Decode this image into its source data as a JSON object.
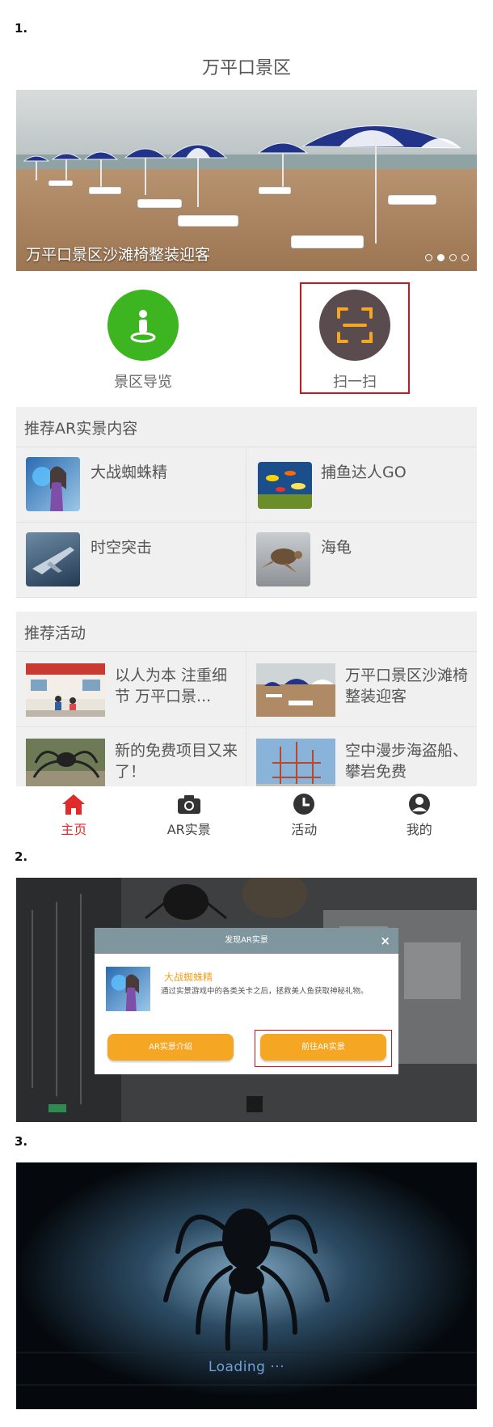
{
  "steps": [
    "1.",
    "2.",
    "3."
  ],
  "app": {
    "title": "万平口景区"
  },
  "banner": {
    "caption": "万平口景区沙滩椅整装迎客",
    "slide_count": 4,
    "active_slide": 2
  },
  "quick_entries": [
    {
      "label": "景区导览",
      "icon": "person-pin-icon",
      "color": "#3cb521"
    },
    {
      "label": "扫一扫",
      "icon": "scan-icon",
      "color": "#5a4b4f"
    }
  ],
  "ar_section": {
    "title": "推荐AR实景内容",
    "items": [
      {
        "name": "大战蜘蛛精",
        "icon": "mermaid-thumbnail"
      },
      {
        "name": "捕鱼达人GO",
        "icon": "fish-thumbnail"
      },
      {
        "name": "时空突击",
        "icon": "jet-thumbnail"
      },
      {
        "name": "海龟",
        "icon": "turtle-thumbnail"
      }
    ]
  },
  "activity_section": {
    "title": "推荐活动",
    "items": [
      {
        "text": "以人为本 注重细节 万平口景...",
        "icon": "service-hall-thumbnail"
      },
      {
        "text": "万平口景区沙滩椅整装迎客",
        "icon": "beach-thumbnail"
      },
      {
        "text": "新的免费项目又来了！",
        "icon": "spider-thumbnail"
      },
      {
        "text": "空中漫步海盗船、攀岩免费",
        "icon": "construction-thumbnail"
      }
    ]
  },
  "tabbar": {
    "tabs": [
      {
        "label": "主页",
        "icon": "home-icon",
        "active": true
      },
      {
        "label": "AR实景",
        "icon": "camera-icon",
        "active": false
      },
      {
        "label": "活动",
        "icon": "clock-icon",
        "active": false
      },
      {
        "label": "我的",
        "icon": "user-icon",
        "active": false
      }
    ]
  },
  "dialog": {
    "header": "发现AR实景",
    "close": "×",
    "title": "大战蜘蛛精",
    "description": "通过实景游戏中的各类关卡之后，拯救美人鱼获取神秘礼物。",
    "buttons": [
      "AR实景介绍",
      "前往AR实景"
    ]
  },
  "loading": {
    "text": "Loading ···"
  },
  "colors": {
    "accent_red": "#e12b2b",
    "highlight_border": "#d0141c",
    "button_orange": "#f5a623",
    "loading_blue": "#6fa0d8"
  }
}
